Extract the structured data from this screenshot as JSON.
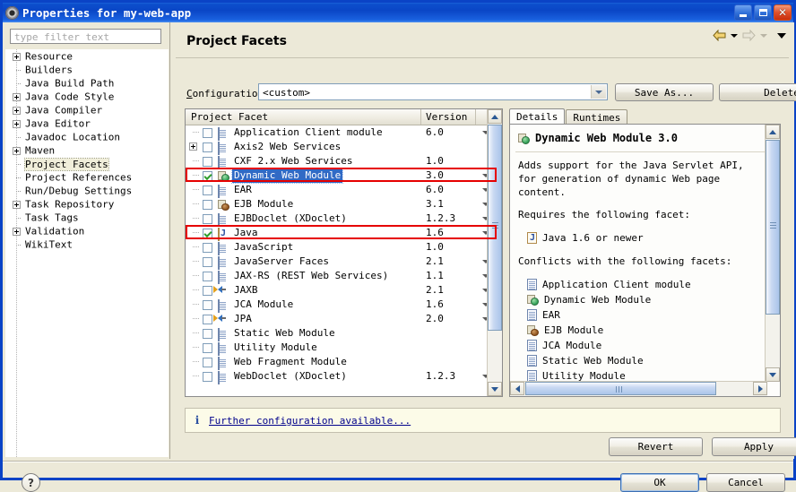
{
  "window": {
    "title": "Properties for my-web-app",
    "icon": "gear-icon",
    "minimize_label": "Minimize",
    "maximize_label": "Maximize",
    "close_label": "✕",
    "titlebar_color": "#0a46c6",
    "chrome_color": "#ece9d8"
  },
  "filter": {
    "placeholder": "type filter text",
    "value": ""
  },
  "sidebar": {
    "items": [
      {
        "label": "Resource",
        "expandable": true,
        "selected": false
      },
      {
        "label": "Builders",
        "expandable": false,
        "selected": false
      },
      {
        "label": "Java Build Path",
        "expandable": false,
        "selected": false
      },
      {
        "label": "Java Code Style",
        "expandable": true,
        "selected": false
      },
      {
        "label": "Java Compiler",
        "expandable": true,
        "selected": false
      },
      {
        "label": "Java Editor",
        "expandable": true,
        "selected": false
      },
      {
        "label": "Javadoc Location",
        "expandable": false,
        "selected": false
      },
      {
        "label": "Maven",
        "expandable": true,
        "selected": false
      },
      {
        "label": "Project Facets",
        "expandable": false,
        "selected": true
      },
      {
        "label": "Project References",
        "expandable": false,
        "selected": false
      },
      {
        "label": "Run/Debug Settings",
        "expandable": false,
        "selected": false
      },
      {
        "label": "Task Repository",
        "expandable": true,
        "selected": false
      },
      {
        "label": "Task Tags",
        "expandable": false,
        "selected": false
      },
      {
        "label": "Validation",
        "expandable": true,
        "selected": false
      },
      {
        "label": "WikiText",
        "expandable": false,
        "selected": false
      }
    ]
  },
  "page": {
    "title": "Project Facets",
    "nav": {
      "back_icon": "back-arrow-icon",
      "back_menu_icon": "chevron-down-icon",
      "forward_icon": "forward-arrow-icon",
      "forward_menu_icon": "chevron-down-icon",
      "view_menu_icon": "chevron-down-icon"
    }
  },
  "configuration": {
    "label": "Configuration:",
    "value": "<custom>",
    "dropdown_icon": "chevron-down-icon",
    "save_as_label": "Save As...",
    "delete_label": "Delete"
  },
  "facets_table": {
    "columns": [
      "Project Facet",
      "Version"
    ],
    "rows": [
      {
        "name": "Application Client module",
        "version": "6.0",
        "checked": false,
        "icon": "doc-icon",
        "expandable": false,
        "has_version_menu": true,
        "selected": false,
        "highlighted": false
      },
      {
        "name": "Axis2 Web Services",
        "version": "",
        "checked": false,
        "icon": "doc-icon",
        "expandable": true,
        "has_version_menu": false,
        "selected": false,
        "highlighted": false
      },
      {
        "name": "CXF 2.x Web Services",
        "version": "1.0",
        "checked": false,
        "icon": "doc-icon",
        "expandable": false,
        "has_version_menu": false,
        "selected": false,
        "highlighted": false
      },
      {
        "name": "Dynamic Web Module",
        "version": "3.0",
        "checked": true,
        "icon": "web-module-icon",
        "expandable": false,
        "has_version_menu": true,
        "selected": true,
        "highlighted": true
      },
      {
        "name": "EAR",
        "version": "6.0",
        "checked": false,
        "icon": "doc-icon",
        "expandable": false,
        "has_version_menu": true,
        "selected": false,
        "highlighted": false
      },
      {
        "name": "EJB Module",
        "version": "3.1",
        "checked": false,
        "icon": "ejb-module-icon",
        "expandable": false,
        "has_version_menu": true,
        "selected": false,
        "highlighted": false
      },
      {
        "name": "EJBDoclet (XDoclet)",
        "version": "1.2.3",
        "checked": false,
        "icon": "doc-icon",
        "expandable": false,
        "has_version_menu": true,
        "selected": false,
        "highlighted": false
      },
      {
        "name": "Java",
        "version": "1.6",
        "checked": true,
        "icon": "java-icon",
        "expandable": false,
        "has_version_menu": true,
        "selected": false,
        "highlighted": true
      },
      {
        "name": "JavaScript",
        "version": "1.0",
        "checked": false,
        "icon": "doc-icon",
        "expandable": false,
        "has_version_menu": false,
        "selected": false,
        "highlighted": false
      },
      {
        "name": "JavaServer Faces",
        "version": "2.1",
        "checked": false,
        "icon": "doc-icon",
        "expandable": false,
        "has_version_menu": true,
        "selected": false,
        "highlighted": false
      },
      {
        "name": "JAX-RS (REST Web Services)",
        "version": "1.1",
        "checked": false,
        "icon": "doc-icon",
        "expandable": false,
        "has_version_menu": true,
        "selected": false,
        "highlighted": false
      },
      {
        "name": "JAXB",
        "version": "2.1",
        "checked": false,
        "icon": "arrows-icon",
        "expandable": false,
        "has_version_menu": true,
        "selected": false,
        "highlighted": false
      },
      {
        "name": "JCA Module",
        "version": "1.6",
        "checked": false,
        "icon": "doc-icon",
        "expandable": false,
        "has_version_menu": true,
        "selected": false,
        "highlighted": false
      },
      {
        "name": "JPA",
        "version": "2.0",
        "checked": false,
        "icon": "arrows-icon",
        "expandable": false,
        "has_version_menu": true,
        "selected": false,
        "highlighted": false
      },
      {
        "name": "Static Web Module",
        "version": "",
        "checked": false,
        "icon": "doc-icon",
        "expandable": false,
        "has_version_menu": false,
        "selected": false,
        "highlighted": false
      },
      {
        "name": "Utility Module",
        "version": "",
        "checked": false,
        "icon": "doc-icon",
        "expandable": false,
        "has_version_menu": false,
        "selected": false,
        "highlighted": false
      },
      {
        "name": "Web Fragment Module",
        "version": "",
        "checked": false,
        "icon": "doc-icon",
        "expandable": false,
        "has_version_menu": false,
        "selected": false,
        "highlighted": false
      },
      {
        "name": "WebDoclet (XDoclet)",
        "version": "1.2.3",
        "checked": false,
        "icon": "doc-icon",
        "expandable": false,
        "has_version_menu": true,
        "selected": false,
        "highlighted": false
      }
    ],
    "highlight_color": "#e60000",
    "selection_color": "#316ac5"
  },
  "details": {
    "tabs": [
      {
        "label": "Details",
        "active": true
      },
      {
        "label": "Runtimes",
        "active": false
      }
    ],
    "heading": "Dynamic Web Module 3.0",
    "heading_icon": "web-module-icon",
    "description": "Adds support for the Java Servlet API, for generation of dynamic Web page content.",
    "requires_label": "Requires the following facet:",
    "requires": [
      {
        "label": "Java 1.6 or newer",
        "icon": "java-icon"
      }
    ],
    "conflicts_label": "Conflicts with the following facets:",
    "conflicts": [
      {
        "label": "Application Client module",
        "icon": "doc-icon"
      },
      {
        "label": "Dynamic Web Module",
        "icon": "web-module-icon"
      },
      {
        "label": "EAR",
        "icon": "doc-icon"
      },
      {
        "label": "EJB Module",
        "icon": "ejb-module-icon"
      },
      {
        "label": "JCA Module",
        "icon": "doc-icon"
      },
      {
        "label": "Static Web Module",
        "icon": "doc-icon"
      },
      {
        "label": "Utility Module",
        "icon": "doc-icon"
      }
    ]
  },
  "infobar": {
    "icon": "info-icon",
    "link_text": "Further configuration available..."
  },
  "buttons": {
    "revert": "Revert",
    "apply": "Apply",
    "ok": "OK",
    "cancel": "Cancel",
    "help_icon": "question-mark-icon"
  }
}
